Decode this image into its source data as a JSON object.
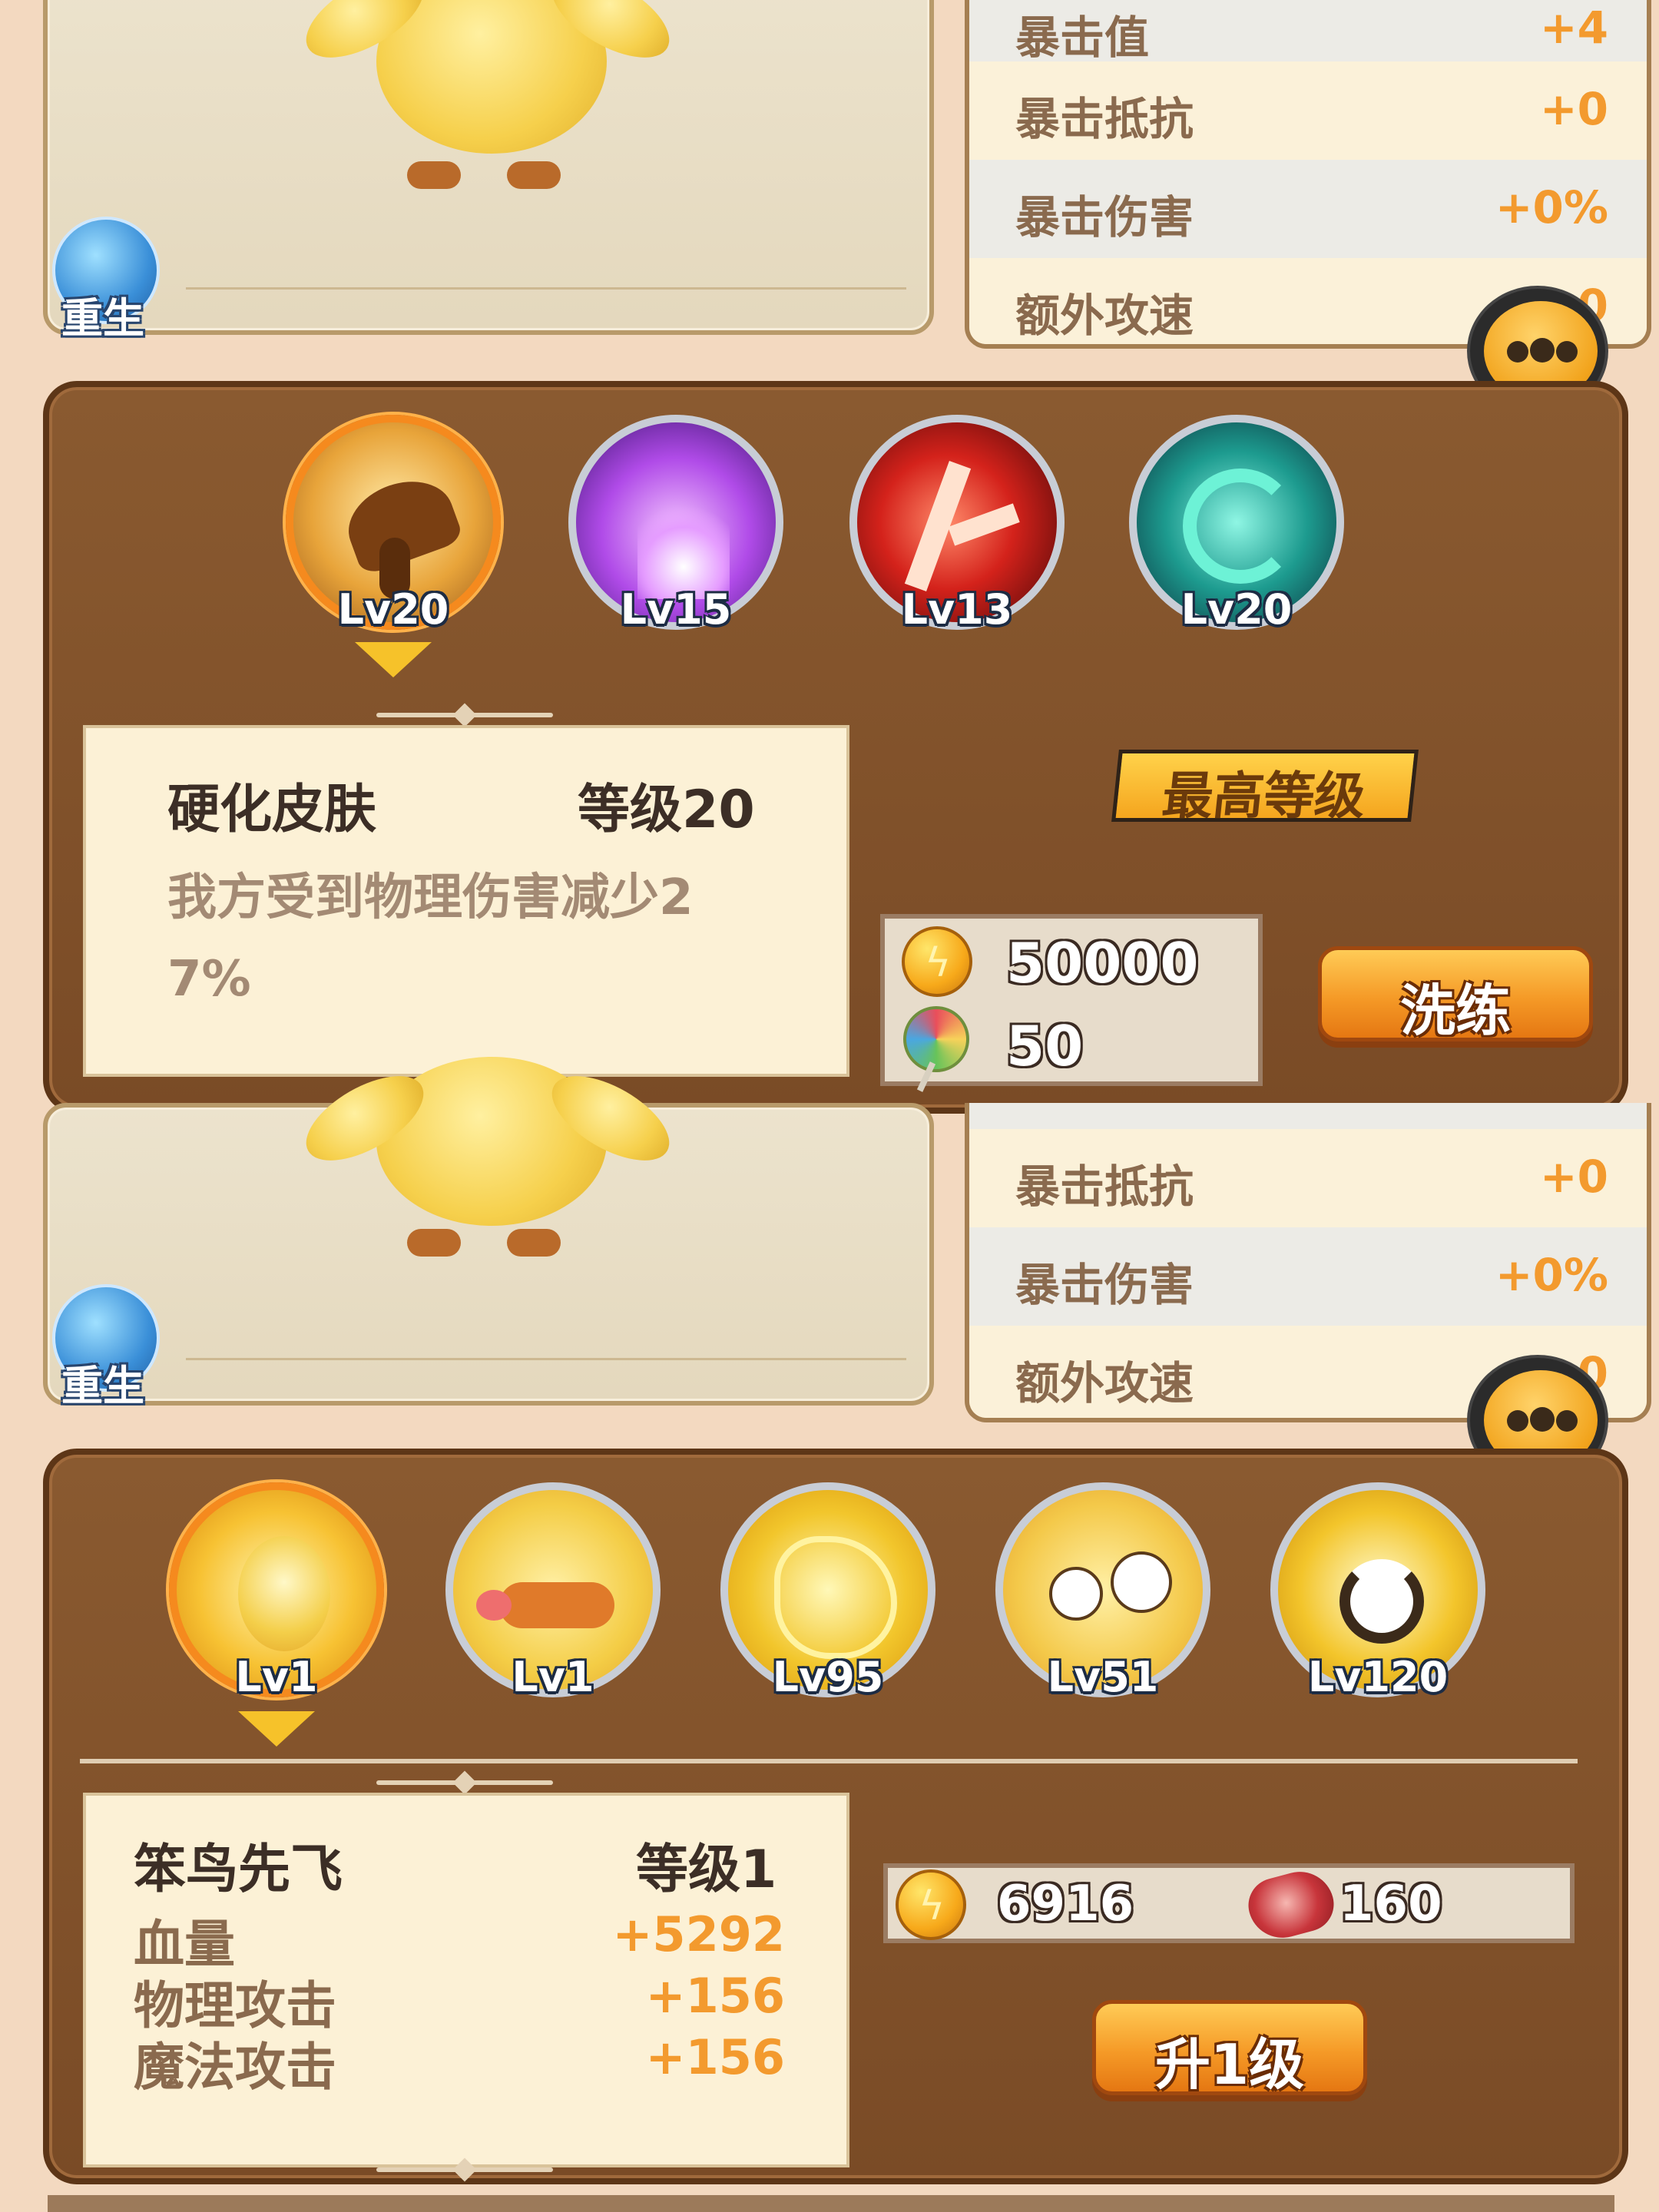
{
  "top_section": {
    "rebirth_label": "重生",
    "chat_label": "聊天",
    "stats": [
      {
        "name": "暴击值",
        "value": "+4"
      },
      {
        "name": "暴击抵抗",
        "value": "+0"
      },
      {
        "name": "暴击伤害",
        "value": "+0%"
      },
      {
        "name": "额外攻速",
        "value": "+0"
      }
    ]
  },
  "skill_panel_1": {
    "skills": [
      {
        "level": "Lv20",
        "icon": "wing-shield-icon",
        "selected": true
      },
      {
        "level": "Lv15",
        "icon": "purple-flame-icon",
        "selected": false
      },
      {
        "level": "Lv13",
        "icon": "red-lightning-icon",
        "selected": false
      },
      {
        "level": "Lv20",
        "icon": "cyan-arrows-icon",
        "selected": false
      }
    ],
    "detail": {
      "name": "硬化皮肤",
      "level_text": "等级20",
      "description_line1": "我方受到物理伤害减少2",
      "description_line2": "7%"
    },
    "max_level_label": "最高等级",
    "costs": {
      "gold": "50000",
      "candy": "50"
    },
    "action_label": "洗练"
  },
  "middle_section": {
    "rebirth_label": "重生",
    "chat_label": "聊天",
    "stats": [
      {
        "name": "暴击抵抗",
        "value": "+0"
      },
      {
        "name": "暴击伤害",
        "value": "+0%"
      },
      {
        "name": "额外攻速",
        "value": "+0"
      }
    ]
  },
  "skill_panel_2": {
    "skills": [
      {
        "level": "Lv1",
        "icon": "duck-glow-icon",
        "selected": true
      },
      {
        "level": "Lv1",
        "icon": "duck-face-icon",
        "selected": false
      },
      {
        "level": "Lv95",
        "icon": "yellow-lightning-icon",
        "selected": false
      },
      {
        "level": "Lv51",
        "icon": "duck-eyes-icon",
        "selected": false
      },
      {
        "level": "Lv120",
        "icon": "yellow-burst-icon",
        "selected": false
      }
    ],
    "detail": {
      "name": "笨鸟先飞",
      "level_text": "等级1",
      "attributes": [
        {
          "name": "血量",
          "value": "+5292"
        },
        {
          "name": "物理攻击",
          "value": "+156"
        },
        {
          "name": "魔法攻击",
          "value": "+156"
        }
      ]
    },
    "costs": {
      "gold": "6916",
      "meat": "160"
    },
    "action_label": "升1级"
  },
  "colors": {
    "accent_orange": "#f39a2e",
    "panel_brown": "#7a4b26",
    "selected_ring": "#f58a1e"
  }
}
